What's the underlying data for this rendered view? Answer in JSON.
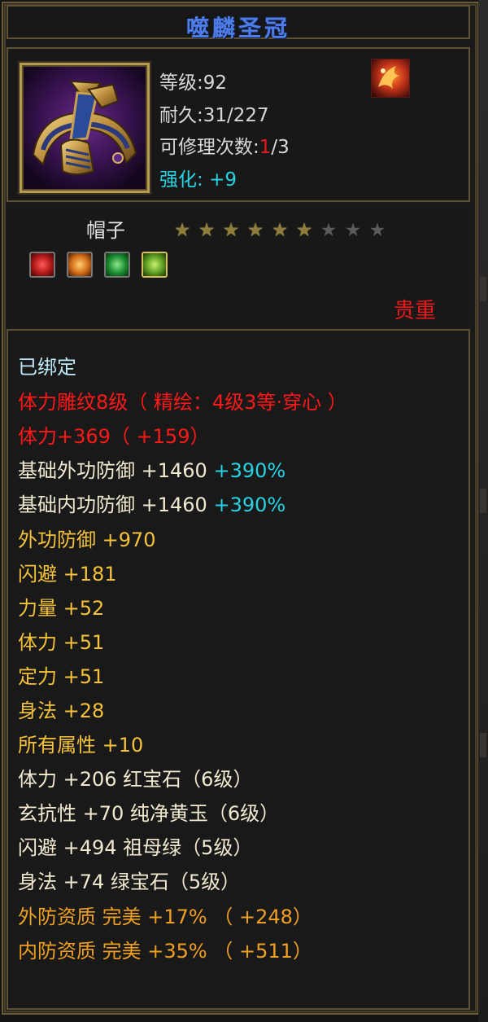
{
  "item": {
    "name": "噬麟圣冠",
    "level_label": "等级:",
    "level_value": "92",
    "durability_label": "耐久:",
    "durability_value": "31/227",
    "repair_label": "可修理次数:",
    "repair_current": "1",
    "repair_total": "/3",
    "enhance_label": "强化:",
    "enhance_value": "+9",
    "type": "帽子",
    "stars_total": 9,
    "stars_filled": 6,
    "rarity": "贵重",
    "icon": "crown-icon",
    "skill_icon": "fire-phoenix-icon"
  },
  "gems": [
    {
      "icon": "red-gem-icon",
      "color": "#d02828"
    },
    {
      "icon": "yellow-gem-icon",
      "color": "#e08a1a"
    },
    {
      "icon": "green-gem-icon",
      "color": "#2aa040"
    },
    {
      "icon": "emerald-gem-icon",
      "color": "#7ac030"
    }
  ],
  "attributes": [
    {
      "text": "已绑定",
      "style": "bound"
    },
    {
      "text": "体力雕纹8级（ 精绘：4级3等·穿心 ）",
      "style": "red"
    },
    {
      "text": "体力+369（ +159）",
      "style": "red"
    },
    {
      "text": "基础外功防御  +1460",
      "extra": " +390%",
      "style": "white"
    },
    {
      "text": "基础内功防御  +1460",
      "extra": " +390%",
      "style": "white"
    },
    {
      "text": "外功防御  +970",
      "style": "gold"
    },
    {
      "text": "闪避  +181",
      "style": "gold"
    },
    {
      "text": "力量  +52",
      "style": "gold"
    },
    {
      "text": "体力  +51",
      "style": "gold"
    },
    {
      "text": "定力  +51",
      "style": "gold"
    },
    {
      "text": "身法  +28",
      "style": "gold"
    },
    {
      "text": "所有属性  +10",
      "style": "gold"
    },
    {
      "text": "体力  +206  红宝石（6级）",
      "style": "white"
    },
    {
      "text": "玄抗性  +70  纯净黄玉（6级）",
      "style": "white"
    },
    {
      "text": "闪避  +494  祖母绿（5级）",
      "style": "white"
    },
    {
      "text": "身法  +74  绿宝石（5级）",
      "style": "white"
    },
    {
      "text": "外防资质    完美  +17% （ +248）",
      "style": "orange"
    },
    {
      "text": "内防资质    完美  +35% （ +511）",
      "style": "orange"
    }
  ]
}
